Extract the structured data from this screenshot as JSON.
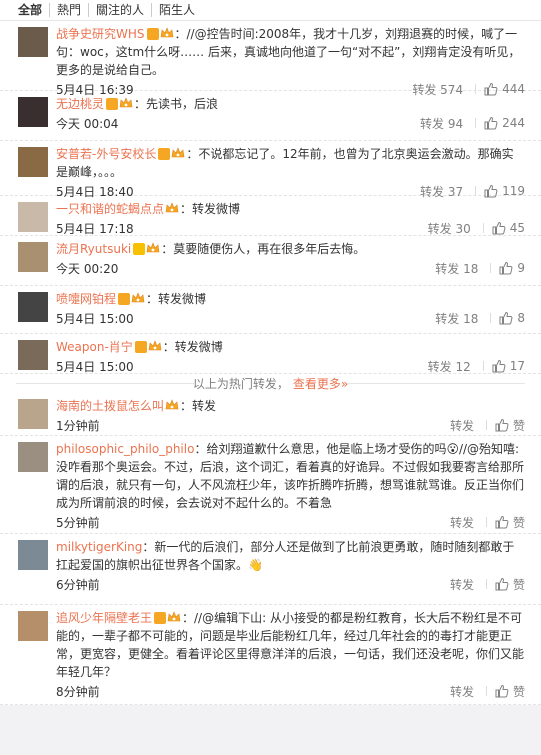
{
  "tabs": [
    "全部",
    "熱門",
    "關注的人",
    "陌生人"
  ],
  "colors": {
    "accent": "#eb7350",
    "badge_orange": "#f5a623",
    "badge_yellow": "#f7c100",
    "text": "#333333",
    "meta": "#808080"
  },
  "hot": [
    {
      "name": "战争史研究WHS",
      "badge": "orange",
      "vip": true,
      "content": "：//@控告时间:2008年，我才十几岁，刘翔退赛的时候，喊了一句：woc，这tm什么呀…… 后来，真诚地向他道了一句“对不起”，刘翔肯定没有听见，更多的是说给自己。",
      "time": "5月4日 16:39",
      "forward": "转发 574",
      "likes": "444"
    },
    {
      "name": "无边桃灵",
      "badge": "orange",
      "vip": true,
      "content": "：先读书，后浪",
      "time": "今天 00:04",
      "forward": "转发 94",
      "likes": "244"
    },
    {
      "name": "安普若-外号安校长",
      "badge": "orange",
      "vip": true,
      "content": "：不说都忘记了。12年前，也曾为了北京奥运会激动。那确实是巅峰，。。。",
      "time": "5月4日 18:40",
      "forward": "转发 37",
      "likes": "119"
    },
    {
      "name": "一只和谐的蛇蝎点点",
      "badge": "",
      "vip": true,
      "content": "：转发微博",
      "time": "5月4日 17:18",
      "forward": "转发 30",
      "likes": "45"
    },
    {
      "name": "流月Ryutsuki",
      "badge": "yellow",
      "vip": true,
      "content": "：莫要随便伤人，再在很多年后去悔。",
      "time": "今天 00:20",
      "forward": "转发 18",
      "likes": "9"
    },
    {
      "name": "喷嚏网铂程",
      "badge": "orange",
      "vip": true,
      "content": "：转发微博",
      "time": "5月4日 15:00",
      "forward": "转发 18",
      "likes": "8"
    },
    {
      "name": "Weapon-肖宁",
      "badge": "orange",
      "vip": true,
      "content": "：转发微博",
      "time": "5月4日 15:00",
      "forward": "转发 12",
      "likes": "17"
    }
  ],
  "divider": {
    "label": "以上为热门转发，",
    "more": "查看更多»"
  },
  "recent": [
    {
      "name": "海南的土拨鼠怎么叫",
      "badge": "",
      "vip": true,
      "content": "：转发",
      "time": "1分钟前",
      "forward": "转发",
      "likes": "赞"
    },
    {
      "name": "philosophic_philo_philo",
      "badge": "",
      "vip": false,
      "content": "：给刘翔道歉什么意思，他是临上场才受伤的吗😮//@殆知嘻:没咋看那个奥运会。不过，后浪，这个词汇，看着真的好诡异。不过假如我要寄言给那所谓的后浪，就只有一句，人不风流枉少年，该咋折腾咋折腾，想骂谁就骂谁。反正当你们成为所谓前浪的时候，会去说对不起什么的。不着急",
      "time": "5分钟前",
      "forward": "转发",
      "likes": "赞"
    },
    {
      "name": "milkytigerKing",
      "badge": "",
      "vip": false,
      "content": "：新一代的后浪们，部分人还是做到了比前浪更勇敢，随时随刻都敢于扛起爱国的旗帜出征世界各个国家。👋",
      "time": "6分钟前",
      "forward": "转发",
      "likes": "赞"
    },
    {
      "name": "追风少年隔壁老王",
      "badge": "orange",
      "vip": true,
      "content": "：//@编辑下山: 从小接受的都是粉红教育，长大后不粉红是不可能的，一辈子都不可能的，问题是毕业后能粉红几年，经过几年社会的的毒打才能更正常，更宽容，更健全。看着评论区里得意洋洋的后浪，一句话，我们还没老呢，你们又能年轻几年？",
      "time": "8分钟前",
      "forward": "转发",
      "likes": "赞"
    }
  ]
}
